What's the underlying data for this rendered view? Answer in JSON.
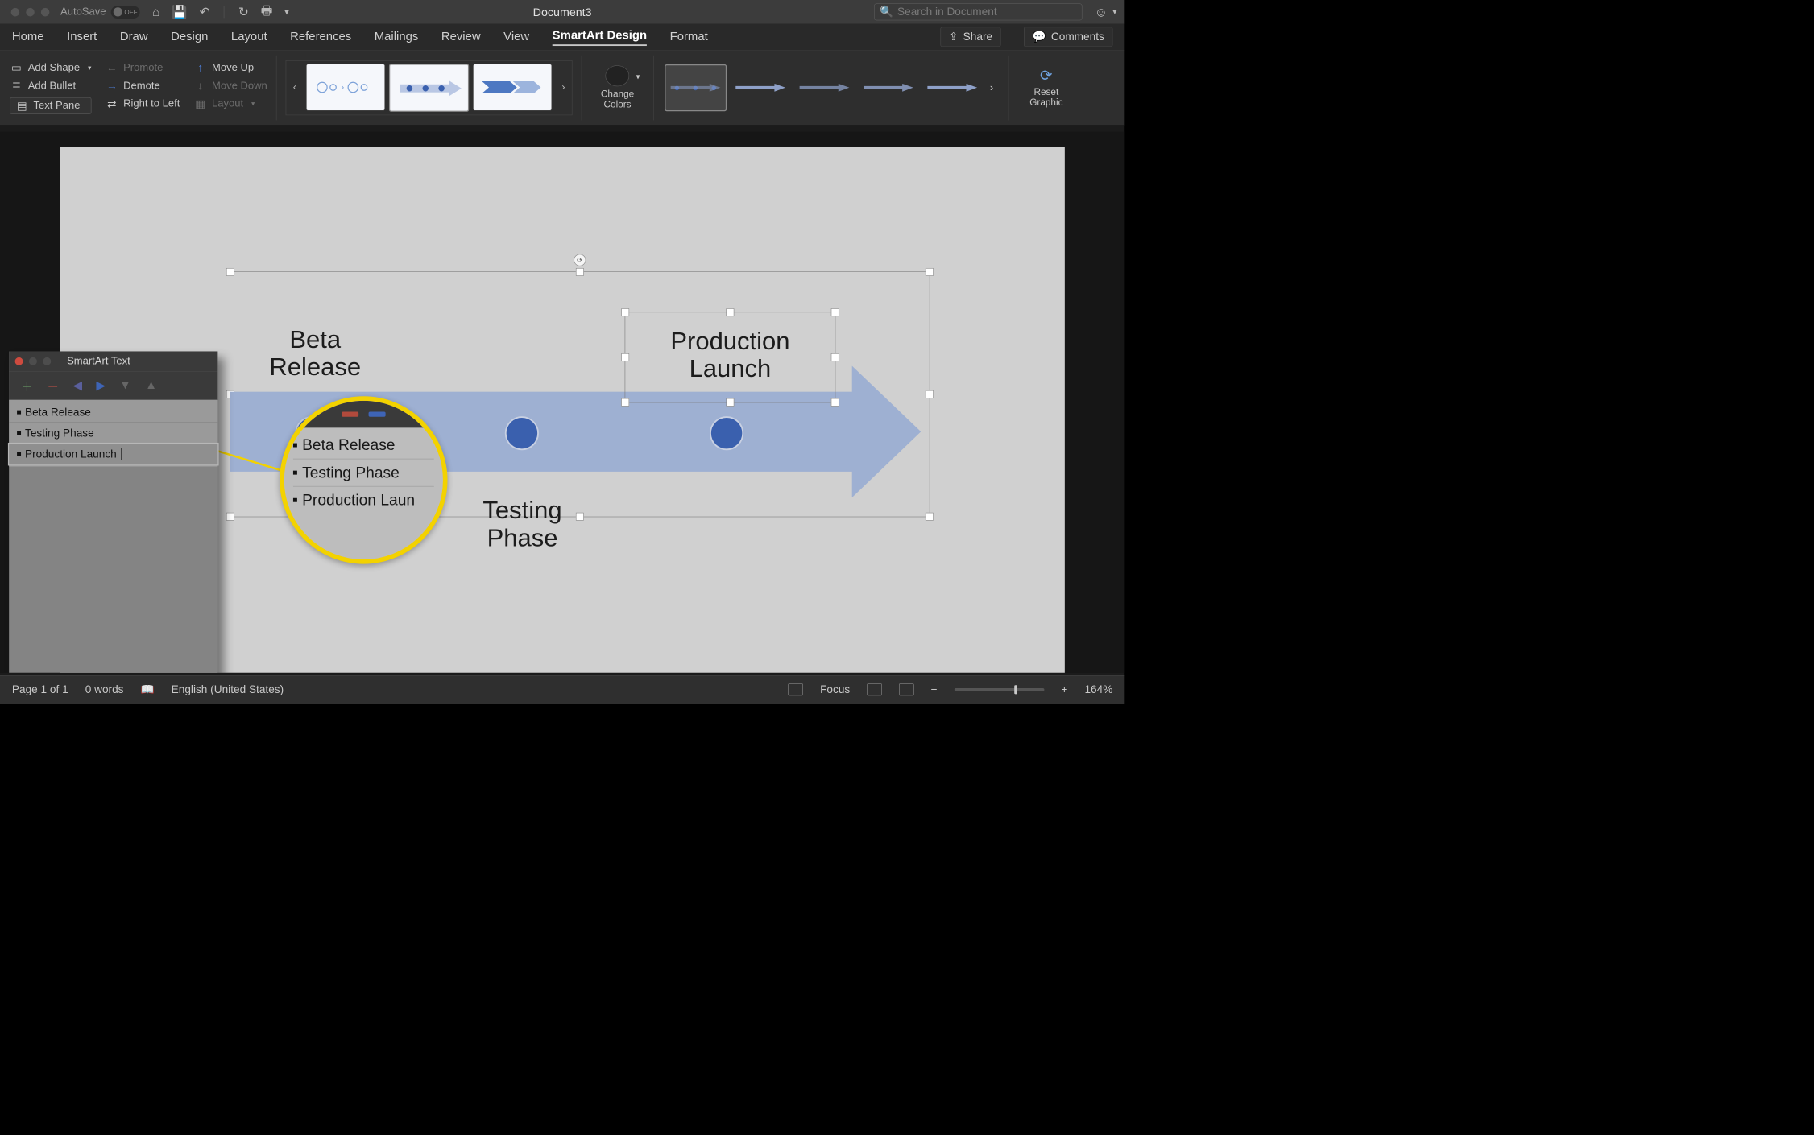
{
  "titlebar": {
    "autosave_label": "AutoSave",
    "autosave_state": "OFF",
    "doc_title": "Document3",
    "search_placeholder": "Search in Document"
  },
  "tabs": [
    "Home",
    "Insert",
    "Draw",
    "Design",
    "Layout",
    "References",
    "Mailings",
    "Review",
    "View",
    "SmartArt Design",
    "Format"
  ],
  "share": "Share",
  "comments": "Comments",
  "ribbon": {
    "add_shape": "Add Shape",
    "add_bullet": "Add Bullet",
    "text_pane": "Text Pane",
    "promote": "Promote",
    "demote": "Demote",
    "rtl": "Right to Left",
    "move_up": "Move Up",
    "move_down": "Move Down",
    "layout": "Layout",
    "change_colors": "Change\nColors",
    "reset": "Reset\nGraphic"
  },
  "text_pane": {
    "title": "SmartArt Text",
    "items": [
      "Beta Release",
      "Testing Phase",
      "Production Launch"
    ]
  },
  "magnifier_items": [
    "Beta Release",
    "Testing Phase",
    "Production Laun"
  ],
  "smartart": {
    "node1": "Beta\nRelease",
    "node2": "Testing\nPhase",
    "node3": "Production\nLaunch"
  },
  "status": {
    "page": "Page 1 of 1",
    "words": "0 words",
    "lang": "English (United States)",
    "focus": "Focus",
    "zoom": "164%"
  }
}
